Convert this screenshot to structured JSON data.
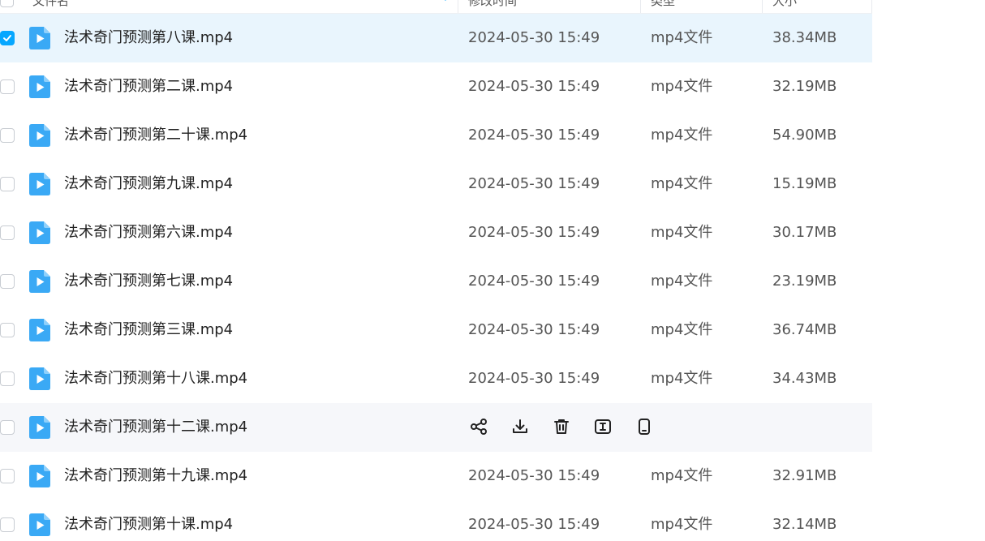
{
  "header": {
    "col_name": "文件名",
    "col_time": "修改时间",
    "col_type": "类型",
    "col_size": "大小"
  },
  "files": [
    {
      "name": "法术奇门预测第八课.mp4",
      "time": "2024-05-30 15:49",
      "type": "mp4文件",
      "size": "38.34MB",
      "selected": true
    },
    {
      "name": "法术奇门预测第二课.mp4",
      "time": "2024-05-30 15:49",
      "type": "mp4文件",
      "size": "32.19MB"
    },
    {
      "name": "法术奇门预测第二十课.mp4",
      "time": "2024-05-30 15:49",
      "type": "mp4文件",
      "size": "54.90MB"
    },
    {
      "name": "法术奇门预测第九课.mp4",
      "time": "2024-05-30 15:49",
      "type": "mp4文件",
      "size": "15.19MB"
    },
    {
      "name": "法术奇门预测第六课.mp4",
      "time": "2024-05-30 15:49",
      "type": "mp4文件",
      "size": "30.17MB"
    },
    {
      "name": "法术奇门预测第七课.mp4",
      "time": "2024-05-30 15:49",
      "type": "mp4文件",
      "size": "23.19MB"
    },
    {
      "name": "法术奇门预测第三课.mp4",
      "time": "2024-05-30 15:49",
      "type": "mp4文件",
      "size": "36.74MB"
    },
    {
      "name": "法术奇门预测第十八课.mp4",
      "time": "2024-05-30 15:49",
      "type": "mp4文件",
      "size": "34.43MB"
    },
    {
      "name": "法术奇门预测第十二课.mp4",
      "time": "",
      "type": "",
      "size": "",
      "hovered": true
    },
    {
      "name": "法术奇门预测第十九课.mp4",
      "time": "2024-05-30 15:49",
      "type": "mp4文件",
      "size": "32.91MB"
    },
    {
      "name": "法术奇门预测第十课.mp4",
      "time": "2024-05-30 15:49",
      "type": "mp4文件",
      "size": "32.14MB"
    }
  ],
  "hover_actions": [
    "share-icon",
    "download-icon",
    "delete-icon",
    "rename-icon",
    "send-to-phone-icon"
  ],
  "colors": {
    "accent": "#06a7ff",
    "selected_row": "#e9f5fd",
    "hover_row": "#f6f7fa",
    "file_icon": "#3aa9f5"
  }
}
